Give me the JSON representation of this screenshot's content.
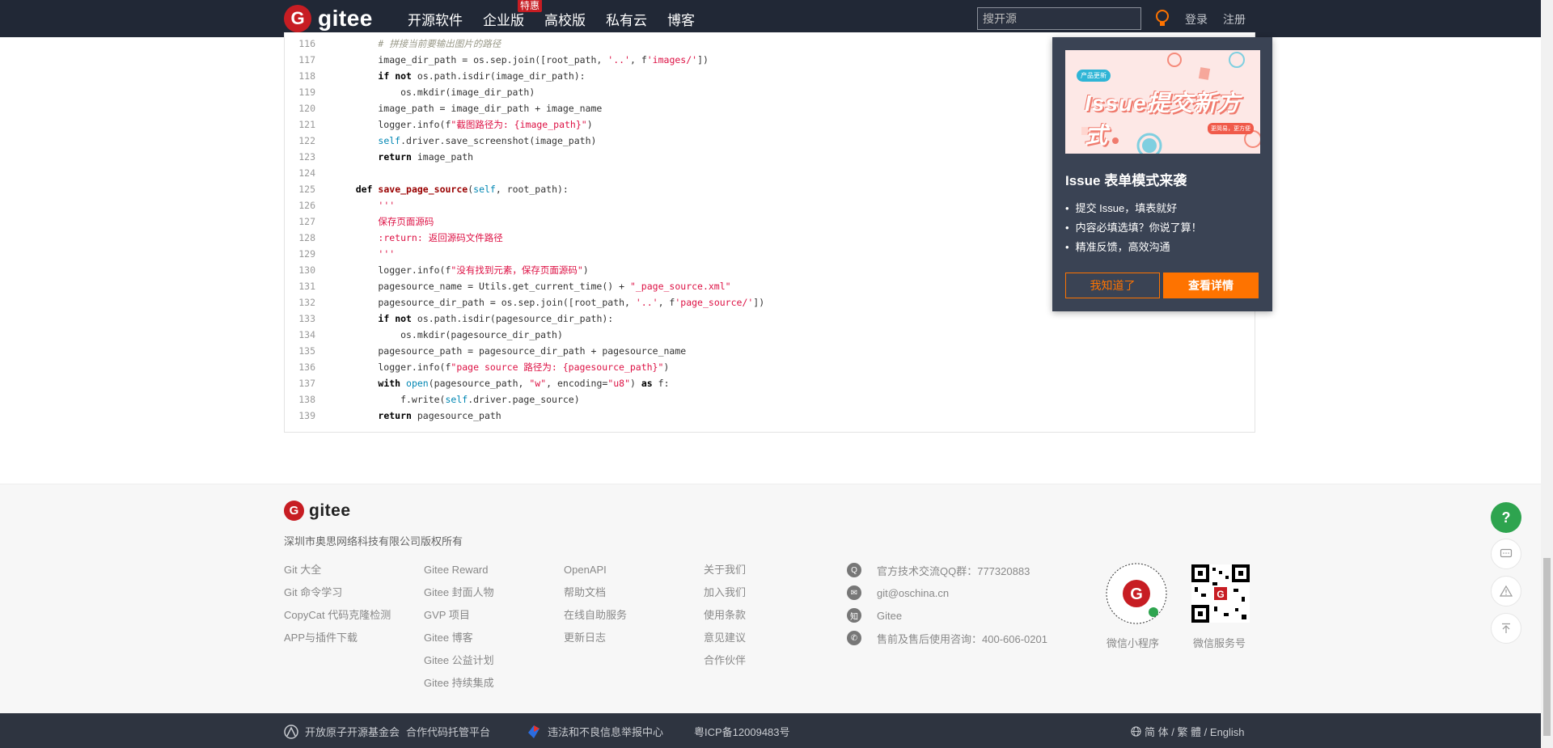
{
  "header": {
    "logo_text": "gitee",
    "logo_letter": "G",
    "nav": [
      {
        "label": "开源软件"
      },
      {
        "label": "企业版",
        "badge": "特惠"
      },
      {
        "label": "高校版"
      },
      {
        "label": "私有云"
      },
      {
        "label": "博客"
      }
    ],
    "search_placeholder": "搜开源",
    "login": "登录",
    "register": "注册"
  },
  "code": {
    "lines": [
      {
        "n": "116",
        "html": "        <span class=\"cmt\"># 拼接当前要输出图片的路径</span>"
      },
      {
        "n": "117",
        "html": "        image_dir_path = os.sep.join([root_path, <span class=\"str\">'..'</span>, f<span class=\"str\">'images/'</span>])"
      },
      {
        "n": "118",
        "html": "        <span class=\"kw\">if</span> <span class=\"kw\">not</span> os.path.isdir(image_dir_path):"
      },
      {
        "n": "119",
        "html": "            os.mkdir(image_dir_path)"
      },
      {
        "n": "120",
        "html": "        image_path = image_dir_path + image_name"
      },
      {
        "n": "121",
        "html": "        logger.info(f<span class=\"str\">\"截图路径为: {image_path}\"</span>)"
      },
      {
        "n": "122",
        "html": "        <span class=\"bi\">self</span>.driver.save_screenshot(image_path)"
      },
      {
        "n": "123",
        "html": "        <span class=\"kw\">return</span> image_path"
      },
      {
        "n": "124",
        "html": ""
      },
      {
        "n": "125",
        "html": "    <span class=\"kw\">def</span> <span class=\"fn\">save_page_source</span>(<span class=\"bi\">self</span>, root_path):"
      },
      {
        "n": "126",
        "html": "        <span class=\"str\">'''</span>"
      },
      {
        "n": "127",
        "html": "        <span class=\"str\">保存页面源码</span>"
      },
      {
        "n": "128",
        "html": "        <span class=\"str\">:return: 返回源码文件路径</span>"
      },
      {
        "n": "129",
        "html": "        <span class=\"str\">'''</span>"
      },
      {
        "n": "130",
        "html": "        logger.info(f<span class=\"str\">\"没有找到元素，保存页面源码\"</span>)"
      },
      {
        "n": "131",
        "html": "        pagesource_name = Utils.get_current_time() + <span class=\"str\">\"_page_source.xml\"</span>"
      },
      {
        "n": "132",
        "html": "        pagesource_dir_path = os.sep.join([root_path, <span class=\"str\">'..'</span>, f<span class=\"str\">'page_source/'</span>])"
      },
      {
        "n": "133",
        "html": "        <span class=\"kw\">if</span> <span class=\"kw\">not</span> os.path.isdir(pagesource_dir_path):"
      },
      {
        "n": "134",
        "html": "            os.mkdir(pagesource_dir_path)"
      },
      {
        "n": "135",
        "html": "        pagesource_path = pagesource_dir_path + pagesource_name"
      },
      {
        "n": "136",
        "html": "        logger.info(f<span class=\"str\">\"page source 路径为: {pagesource_path}\"</span>)"
      },
      {
        "n": "137",
        "html": "        <span class=\"kw\">with</span> <span class=\"bi\">open</span>(pagesource_path, <span class=\"str\">\"w\"</span>, encoding=<span class=\"str\">\"u8\"</span>) <span class=\"kw\">as</span> f:"
      },
      {
        "n": "138",
        "html": "            f.write(<span class=\"bi\">self</span>.driver.page_source)"
      },
      {
        "n": "139",
        "html": "        <span class=\"kw\">return</span> pagesource_path"
      }
    ]
  },
  "popup": {
    "banner_text": "Issue提交新方式",
    "banner_tag": "产品更新",
    "banner_tag2": "更简易，更方便",
    "title": "Issue 表单模式来袭",
    "items": [
      "提交 Issue，填表就好",
      "内容必填选填？你说了算！",
      "精准反馈，高效沟通"
    ],
    "btn_know": "我知道了",
    "btn_detail": "查看详情"
  },
  "footer": {
    "logo_text": "gitee",
    "company": "深圳市奥思网络科技有限公司版权所有",
    "col1": [
      "Git 大全",
      "Git 命令学习",
      "CopyCat 代码克隆检测",
      "APP与插件下载"
    ],
    "col2": [
      "Gitee Reward",
      "Gitee 封面人物",
      "GVP 项目",
      "Gitee 博客",
      "Gitee 公益计划",
      "Gitee 持续集成"
    ],
    "col3": [
      "OpenAPI",
      "帮助文档",
      "在线自助服务",
      "更新日志"
    ],
    "col4": [
      "关于我们",
      "加入我们",
      "使用条款",
      "意见建议",
      "合作伙伴"
    ],
    "contact": [
      {
        "icon": "qq-icon",
        "glyph": "Q",
        "text": "官方技术交流QQ群：777320883"
      },
      {
        "icon": "email-icon",
        "glyph": "✉",
        "text": "git@oschina.cn"
      },
      {
        "icon": "zhihu-icon",
        "glyph": "知",
        "text": "Gitee"
      },
      {
        "icon": "phone-icon",
        "glyph": "✆",
        "text": "售前及售后使用咨询：400-606-0201"
      }
    ],
    "qr1_label": "微信小程序",
    "qr2_label": "微信服务号"
  },
  "bottom": {
    "foundation": "开放原子开源基金会",
    "partner": "合作代码托管平台",
    "report": "违法和不良信息举报中心",
    "icp": "粤ICP备12009483号",
    "lang": "简 体 / 繁 體 / English"
  },
  "floating": {
    "help": "?"
  }
}
